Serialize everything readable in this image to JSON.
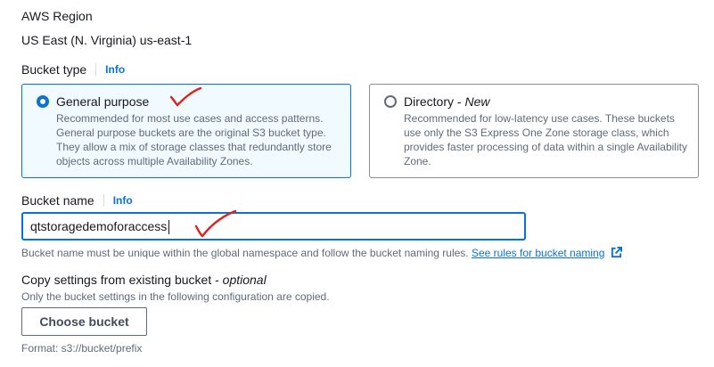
{
  "region": {
    "label": "AWS Region",
    "value": "US East (N. Virginia) us-east-1"
  },
  "bucket_type": {
    "label": "Bucket type",
    "info": "Info",
    "options": [
      {
        "title": "General purpose",
        "title_suffix": "",
        "description": "Recommended for most use cases and access patterns. General purpose buckets are the original S3 bucket type. They allow a mix of storage classes that redundantly store objects across multiple Availability Zones.",
        "selected": true
      },
      {
        "title": "Directory - ",
        "title_suffix": "New",
        "description": "Recommended for low-latency use cases. These buckets use only the S3 Express One Zone storage class, which provides faster processing of data within a single Availability Zone.",
        "selected": false
      }
    ]
  },
  "bucket_name": {
    "label": "Bucket name",
    "info": "Info",
    "value": "qtstoragedemoforaccess",
    "hint": "Bucket name must be unique within the global namespace and follow the bucket naming rules.",
    "hint_link": "See rules for bucket naming"
  },
  "copy_settings": {
    "title": "Copy settings from existing bucket - ",
    "title_suffix": "optional",
    "description": "Only the bucket settings in the following configuration are copied.",
    "button_label": "Choose bucket",
    "format_hint": "Format: s3://bucket/prefix"
  },
  "colors": {
    "accent": "#0972d3",
    "annotation": "#e0201b"
  },
  "icons": {
    "external_link": "external-link-icon",
    "annotation": "red-checkmark-annotation"
  }
}
